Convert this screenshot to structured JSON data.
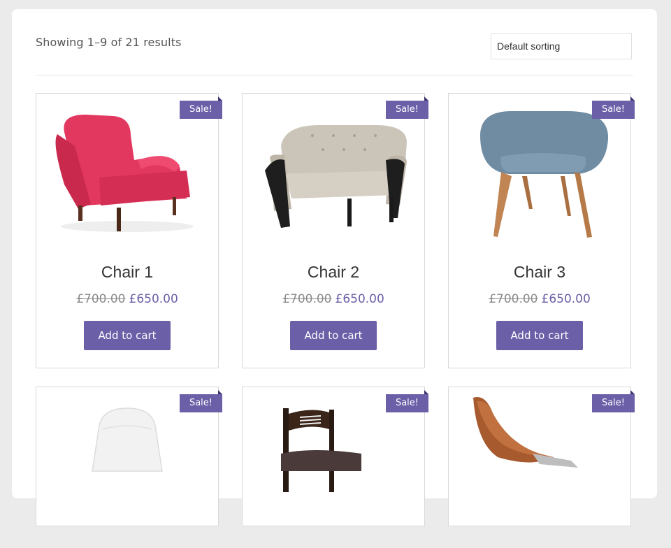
{
  "toolbar": {
    "result_count": "Showing 1–9 of 21 results",
    "sort_selected": "Default sorting"
  },
  "colors": {
    "accent": "#6b5fa8",
    "page_bg": "#ebebeb"
  },
  "products": [
    {
      "title": "Chair 1",
      "old_price": "£700.00",
      "price": "£650.00",
      "sale_badge": "Sale!",
      "button": "Add to cart",
      "image": "pink-armchair"
    },
    {
      "title": "Chair 2",
      "old_price": "£700.00",
      "price": "£650.00",
      "sale_badge": "Sale!",
      "button": "Add to cart",
      "image": "tufted-armchair"
    },
    {
      "title": "Chair 3",
      "old_price": "£700.00",
      "price": "£650.00",
      "sale_badge": "Sale!",
      "button": "Add to cart",
      "image": "blue-tub-chair"
    },
    {
      "sale_badge": "Sale!",
      "image": "white-shell-chair"
    },
    {
      "sale_badge": "Sale!",
      "image": "bar-stool"
    },
    {
      "sale_badge": "Sale!",
      "image": "leather-lounge-chair"
    }
  ]
}
